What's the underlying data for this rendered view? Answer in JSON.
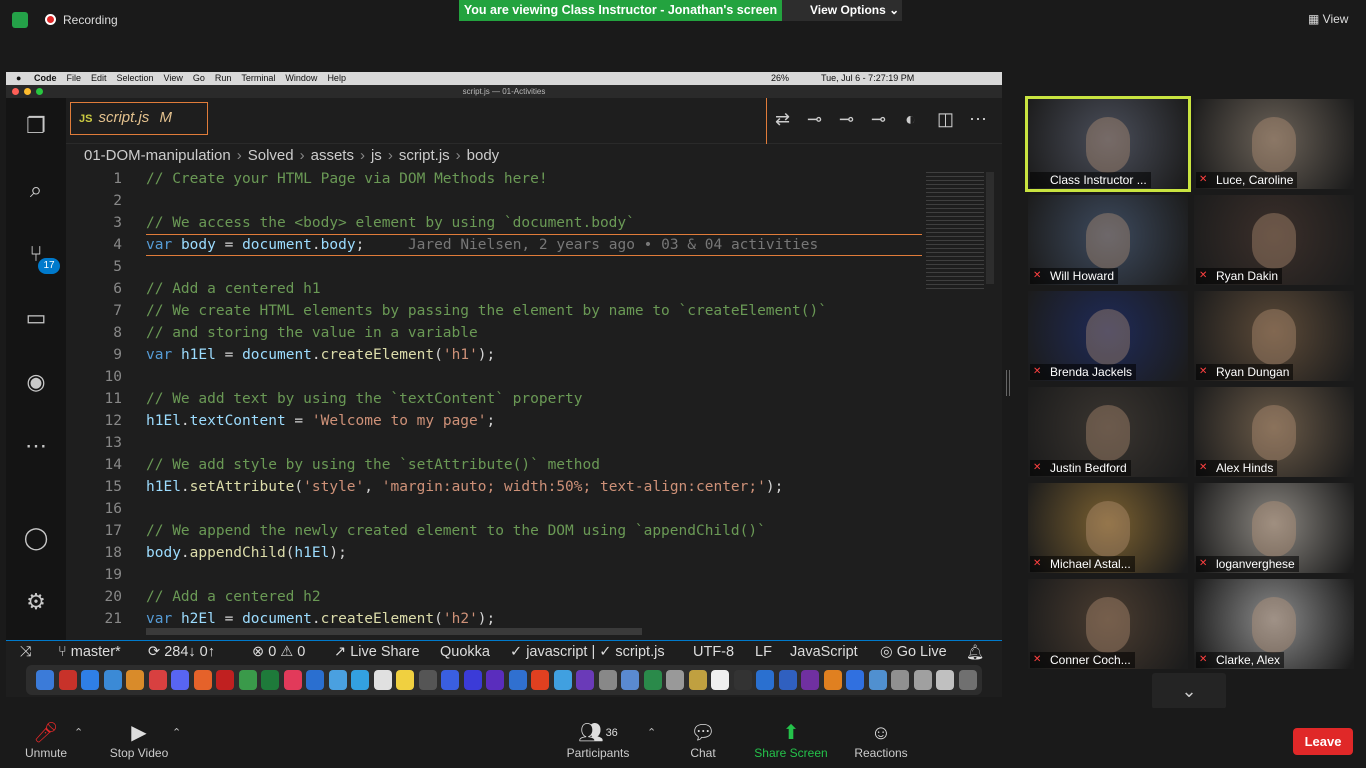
{
  "zoom_top": {
    "recording_label": "Recording",
    "viewing_banner": "You are viewing Class Instructor - Jonathan's screen",
    "view_options_label": "View Options",
    "view_label": "View"
  },
  "mac": {
    "menu": [
      "Code",
      "File",
      "Edit",
      "Selection",
      "View",
      "Go",
      "Run",
      "Terminal",
      "Window",
      "Help"
    ],
    "battery": "26%",
    "clock": "Tue, Jul 6 - 7:27:19 PM",
    "window_title": "script.js — 01-Activities"
  },
  "vscode": {
    "tab": {
      "icon": "JS",
      "name": "script.js",
      "status": "M"
    },
    "source_control_badge": "17",
    "breadcrumb": [
      "01-DOM-manipulation",
      "Solved",
      "assets",
      "js",
      "script.js",
      "body"
    ],
    "lines": [
      {
        "n": "1",
        "parts": [
          {
            "t": "// Create your HTML Page via DOM Methods here!",
            "c": "cm"
          }
        ]
      },
      {
        "n": "2",
        "parts": []
      },
      {
        "n": "3",
        "parts": [
          {
            "t": "// We access the <body> element by using `document.body`",
            "c": "cm"
          }
        ]
      },
      {
        "n": "4",
        "parts": [
          {
            "t": "var",
            "c": "kw"
          },
          {
            "t": " ",
            "c": "pl"
          },
          {
            "t": "body",
            "c": "var"
          },
          {
            "t": " = ",
            "c": "pl"
          },
          {
            "t": "document",
            "c": "var"
          },
          {
            "t": ".",
            "c": "pl"
          },
          {
            "t": "body",
            "c": "var"
          },
          {
            "t": ";",
            "c": "pl"
          },
          {
            "t": "     Jared Nielsen, 2 years ago • 03 & 04 activities",
            "c": "blame"
          }
        ]
      },
      {
        "n": "5",
        "parts": []
      },
      {
        "n": "6",
        "parts": [
          {
            "t": "// Add a centered h1",
            "c": "cm"
          }
        ]
      },
      {
        "n": "7",
        "parts": [
          {
            "t": "// We create HTML elements by passing the element by name to `createElement()`",
            "c": "cm"
          }
        ]
      },
      {
        "n": "8",
        "parts": [
          {
            "t": "// and storing the value in a variable",
            "c": "cm"
          }
        ]
      },
      {
        "n": "9",
        "parts": [
          {
            "t": "var",
            "c": "kw"
          },
          {
            "t": " ",
            "c": "pl"
          },
          {
            "t": "h1El",
            "c": "var"
          },
          {
            "t": " = ",
            "c": "pl"
          },
          {
            "t": "document",
            "c": "var"
          },
          {
            "t": ".",
            "c": "pl"
          },
          {
            "t": "createElement",
            "c": "fn"
          },
          {
            "t": "(",
            "c": "pl"
          },
          {
            "t": "'h1'",
            "c": "str"
          },
          {
            "t": ");",
            "c": "pl"
          }
        ]
      },
      {
        "n": "10",
        "parts": []
      },
      {
        "n": "11",
        "parts": [
          {
            "t": "// We add text by using the `textContent` property",
            "c": "cm"
          }
        ]
      },
      {
        "n": "12",
        "parts": [
          {
            "t": "h1El",
            "c": "var"
          },
          {
            "t": ".",
            "c": "pl"
          },
          {
            "t": "textContent",
            "c": "var"
          },
          {
            "t": " = ",
            "c": "pl"
          },
          {
            "t": "'Welcome to my page'",
            "c": "str"
          },
          {
            "t": ";",
            "c": "pl"
          }
        ]
      },
      {
        "n": "13",
        "parts": []
      },
      {
        "n": "14",
        "parts": [
          {
            "t": "// We add style by using the `setAttribute()` method",
            "c": "cm"
          }
        ]
      },
      {
        "n": "15",
        "parts": [
          {
            "t": "h1El",
            "c": "var"
          },
          {
            "t": ".",
            "c": "pl"
          },
          {
            "t": "setAttribute",
            "c": "fn"
          },
          {
            "t": "(",
            "c": "pl"
          },
          {
            "t": "'style'",
            "c": "str"
          },
          {
            "t": ", ",
            "c": "pl"
          },
          {
            "t": "'margin:auto; width:50%; text-align:center;'",
            "c": "str"
          },
          {
            "t": ");",
            "c": "pl"
          }
        ]
      },
      {
        "n": "16",
        "parts": []
      },
      {
        "n": "17",
        "parts": [
          {
            "t": "// We append the newly created element to the DOM using `appendChild()`",
            "c": "cm"
          }
        ]
      },
      {
        "n": "18",
        "parts": [
          {
            "t": "body",
            "c": "var"
          },
          {
            "t": ".",
            "c": "pl"
          },
          {
            "t": "appendChild",
            "c": "fn"
          },
          {
            "t": "(",
            "c": "pl"
          },
          {
            "t": "h1El",
            "c": "var"
          },
          {
            "t": ");",
            "c": "pl"
          }
        ]
      },
      {
        "n": "19",
        "parts": []
      },
      {
        "n": "20",
        "parts": [
          {
            "t": "// Add a centered h2",
            "c": "cm"
          }
        ]
      },
      {
        "n": "21",
        "parts": [
          {
            "t": "var",
            "c": "kw"
          },
          {
            "t": " ",
            "c": "pl"
          },
          {
            "t": "h2El",
            "c": "var"
          },
          {
            "t": " = ",
            "c": "pl"
          },
          {
            "t": "document",
            "c": "var"
          },
          {
            "t": ".",
            "c": "pl"
          },
          {
            "t": "createElement",
            "c": "fn"
          },
          {
            "t": "(",
            "c": "pl"
          },
          {
            "t": "'h2'",
            "c": "str"
          },
          {
            "t": ");",
            "c": "pl"
          }
        ]
      }
    ],
    "status": {
      "branch": "master*",
      "sync": "284↓ 0↑",
      "problems": "0 ⚠ 0",
      "live_share": "Live Share",
      "quokka": "Quokka",
      "lang_check": "javascript | ✓ script.js",
      "encoding": "UTF-8",
      "eol": "LF",
      "language": "JavaScript",
      "go_live": "Go Live"
    }
  },
  "participants": [
    {
      "name": "Class Instructor ...",
      "color": "#4a4e5a"
    },
    {
      "name": "Luce, Caroline",
      "color": "#6b6258"
    },
    {
      "name": "Will Howard",
      "color": "#3d4a5e"
    },
    {
      "name": "Ryan Dakin",
      "color": "#3b2f2a"
    },
    {
      "name": "Brenda Jackels",
      "color": "#1e2a58"
    },
    {
      "name": "Ryan Dungan",
      "color": "#5c4a38"
    },
    {
      "name": "Justin Bedford",
      "color": "#3a3530"
    },
    {
      "name": "Alex Hinds",
      "color": "#6a5a48"
    },
    {
      "name": "Michael Astal...",
      "color": "#7a6030"
    },
    {
      "name": "loganverghese",
      "color": "#8a8680"
    },
    {
      "name": "Conner Coch...",
      "color": "#4a3c30"
    },
    {
      "name": "Clarke, Alex",
      "color": "#8a8a8a"
    }
  ],
  "toolbar": {
    "unmute": "Unmute",
    "stop_video": "Stop Video",
    "participants": "Participants",
    "participants_count": "36",
    "chat": "Chat",
    "share_screen": "Share Screen",
    "reactions": "Reactions",
    "leave": "Leave"
  },
  "colors": {
    "accent_green": "#23a33f",
    "leave_red": "#e02828",
    "share_green": "#24c24a"
  }
}
